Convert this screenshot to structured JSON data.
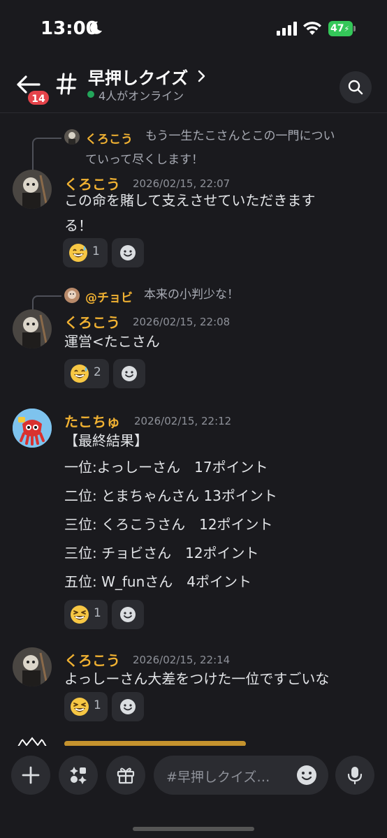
{
  "status_bar": {
    "time": "13:00",
    "battery": "47"
  },
  "header": {
    "badge_count": "14",
    "channel_name": "早押しクイズ",
    "online_status": "4人がオンライン"
  },
  "messages": [
    {
      "reply": {
        "author": "くろこう",
        "line1": "もう一生たこさんとこの一門につい",
        "line2": "ていって尽くします！"
      },
      "author": "くろこう",
      "timestamp": "2026/02/15, 22:07",
      "lines": [
        "この命を賭して支えさせていただきます",
        "る！"
      ],
      "reaction": {
        "emoji": "sweat-smile",
        "count": "1"
      }
    },
    {
      "reply": {
        "author": "@チョビ",
        "line1": "本来の小判少な！"
      },
      "author": "くろこう",
      "timestamp": "2026/02/15, 22:08",
      "lines": [
        "運営<たこさん"
      ],
      "reaction": {
        "emoji": "sweat-smile",
        "count": "2"
      }
    },
    {
      "author": "たこちゅ",
      "timestamp": "2026/02/15, 22:12",
      "lines": [
        "【最終結果】",
        "一位:よっしーさん　17ポイント",
        "二位: とまちゃんさん  13ポイント",
        "三位: くろこうさん　12ポイント",
        "三位: チョビさん　12ポイント",
        "五位: W_funさん　4ポイント"
      ],
      "reaction": {
        "emoji": "laughing",
        "count": "1"
      }
    },
    {
      "author": "くろこう",
      "timestamp": "2026/02/15, 22:14",
      "lines": [
        "よっしーさん大差をつけた一位ですごいな"
      ],
      "reaction": {
        "emoji": "laughing",
        "count": "1"
      }
    }
  ],
  "composer": {
    "placeholder": "#早押しクイズ…"
  },
  "colors": {
    "background": "#1a1a1e",
    "username": "#f0b132",
    "online": "#23a55a",
    "badge": "#e5434a",
    "battery": "#34c759"
  }
}
